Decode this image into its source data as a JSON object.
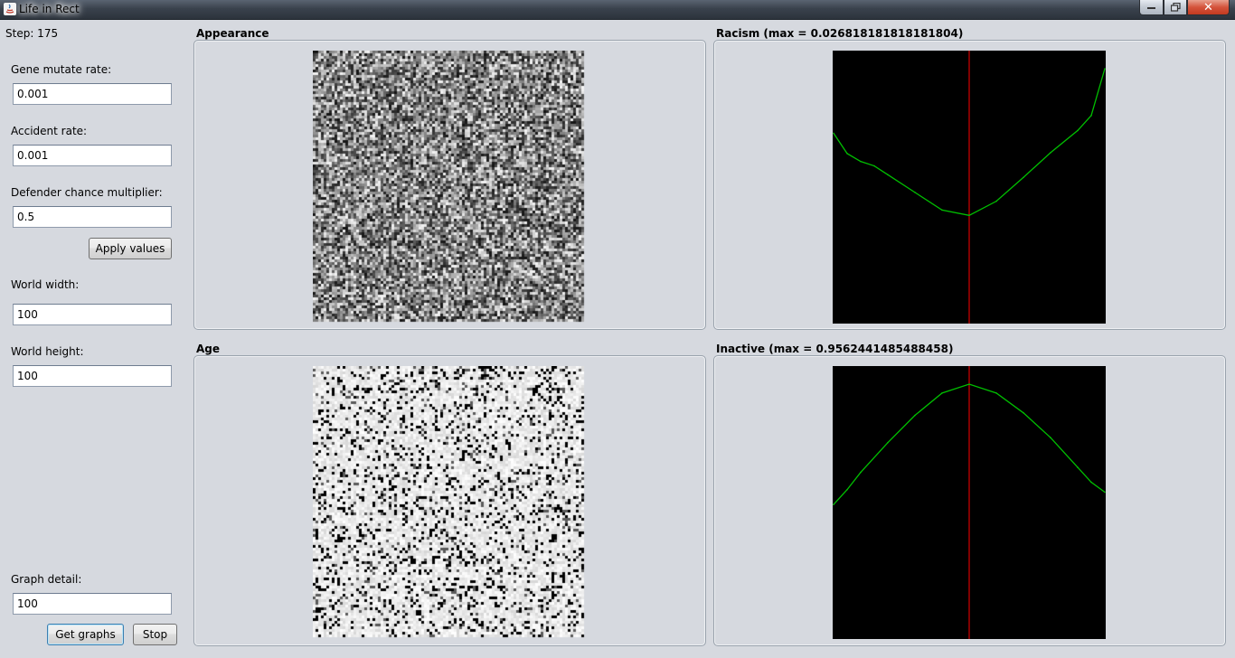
{
  "window": {
    "title": "Life in Rect",
    "close_glyph": "✕"
  },
  "status": {
    "step_label": "Step: 175"
  },
  "controls": {
    "gene_mutate": {
      "label": "Gene mutate rate:",
      "value": "0.001"
    },
    "accident": {
      "label": "Accident rate:",
      "value": "0.001"
    },
    "defender": {
      "label": "Defender chance multiplier:",
      "value": "0.5"
    },
    "apply_label": "Apply values",
    "world_width": {
      "label": "World width:",
      "value": "100"
    },
    "world_height": {
      "label": "World height:",
      "value": "100"
    },
    "graph_detail": {
      "label": "Graph detail:",
      "value": "100"
    },
    "get_graphs_label": "Get graphs",
    "stop_label": "Stop"
  },
  "panels": {
    "appearance": {
      "title": "Appearance"
    },
    "racism": {
      "title": "Racism (max = 0.026818181818181804)"
    },
    "age": {
      "title": "Age"
    },
    "inactive": {
      "title": "Inactive (max = 0.9562441485488458)"
    }
  },
  "chart_data": [
    {
      "type": "line",
      "title": "Racism (max = 0.026818181818181804)",
      "x": [
        0,
        5,
        10,
        15,
        20,
        30,
        40,
        50,
        60,
        70,
        80,
        90,
        95,
        100
      ],
      "series": [
        {
          "color": "#00c000",
          "values": [
            0.0195,
            0.0172,
            0.0163,
            0.0158,
            0.0148,
            0.0128,
            0.0108,
            0.0102,
            0.0118,
            0.0145,
            0.0173,
            0.0198,
            0.0215,
            0.0268
          ]
        }
      ],
      "ylim": [
        0,
        0.0268
      ],
      "center_marker_color": "#ff0000",
      "background": "#000000"
    },
    {
      "type": "line",
      "title": "Inactive (max = 0.9562441485488458)",
      "x": [
        0,
        5,
        10,
        20,
        30,
        40,
        50,
        60,
        70,
        80,
        90,
        95,
        100
      ],
      "series": [
        {
          "color": "#00c000",
          "values": [
            0.47,
            0.53,
            0.6,
            0.72,
            0.83,
            0.92,
            0.956,
            0.92,
            0.84,
            0.74,
            0.62,
            0.56,
            0.52
          ]
        }
      ],
      "ylim": [
        0,
        0.956
      ],
      "center_marker_color": "#ff0000",
      "background": "#000000"
    }
  ]
}
